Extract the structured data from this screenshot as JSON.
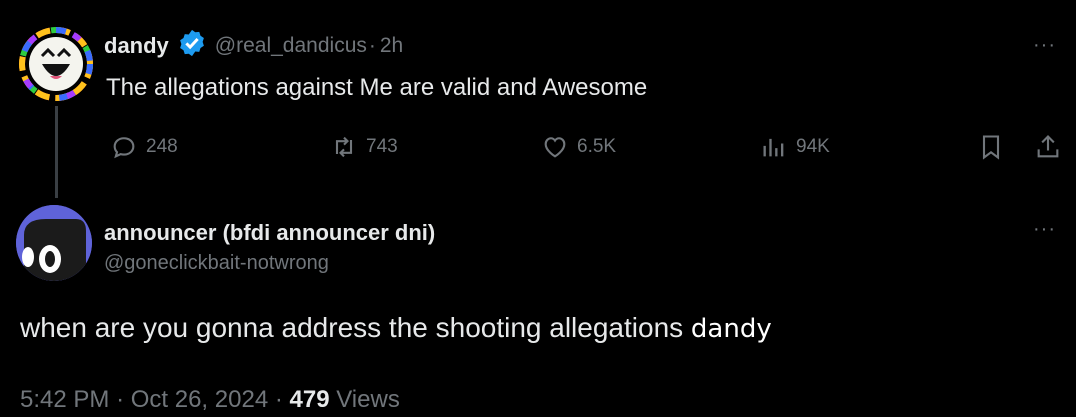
{
  "tweet": {
    "display_name": "dandy",
    "handle": "@real_dandicus",
    "separator": "·",
    "time": "2h",
    "text": "The allegations against Me are valid and Awesome",
    "more_label": "···",
    "actions": {
      "replies": "248",
      "reposts": "743",
      "likes": "6.5K",
      "views": "94K"
    }
  },
  "reply": {
    "display_name": "announcer (bfdi announcer dni)",
    "handle": "@goneclickbait-notwrong",
    "more_label": "···",
    "text": "when are you gonna address the shooting allegations",
    "text_extra": "dandy",
    "time": "5:42 PM",
    "dot1": "·",
    "date": "Oct 26, 2024",
    "dot2": "·",
    "views_count": "479",
    "views_label": "Views"
  },
  "icons": {
    "verified": "verified-badge-icon",
    "reply": "reply-icon",
    "repost": "repost-icon",
    "like": "like-icon",
    "views": "views-icon",
    "bookmark": "bookmark-icon",
    "share": "share-icon",
    "more": "more-icon"
  },
  "colors": {
    "background": "#000000",
    "text": "#e7e9ea",
    "secondary": "#71767b",
    "verified": "#1d9bf0",
    "avatar2": "#5f63d9"
  }
}
